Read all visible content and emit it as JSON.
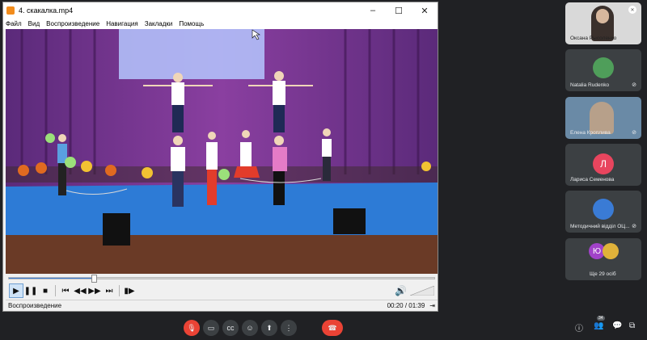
{
  "player": {
    "title": "4. скакалка.mp4",
    "menu": [
      "Файл",
      "Вид",
      "Воспроизведение",
      "Навигация",
      "Закладки",
      "Помощь"
    ],
    "status": "Воспроизведение",
    "time": "00:20 / 01:39",
    "progress": 0.2
  },
  "participants": [
    {
      "name": "Оксана Рысоленко",
      "initial": "",
      "color": "#5a4a46"
    },
    {
      "name": "Natalia Rudenko",
      "initial": "",
      "color": "#4f9e5a"
    },
    {
      "name": "Елена Кроплива",
      "initial": "",
      "color": "#6a8aa6"
    },
    {
      "name": "Лариса Семенова",
      "initial": "Л",
      "color": "#e8455e"
    },
    {
      "name": "Методичний відділ ОЦ...",
      "initial": "",
      "color": "#3a7bd5"
    },
    {
      "name": "Ще 29 осіб",
      "initial": "Ю",
      "color": "#a142c9"
    }
  ],
  "callbar": {
    "people_count": "34",
    "icons": [
      "mic-off-icon",
      "camera-icon",
      "captions-icon",
      "emoji-icon",
      "present-icon",
      "more-icon",
      "end-call-icon"
    ]
  }
}
